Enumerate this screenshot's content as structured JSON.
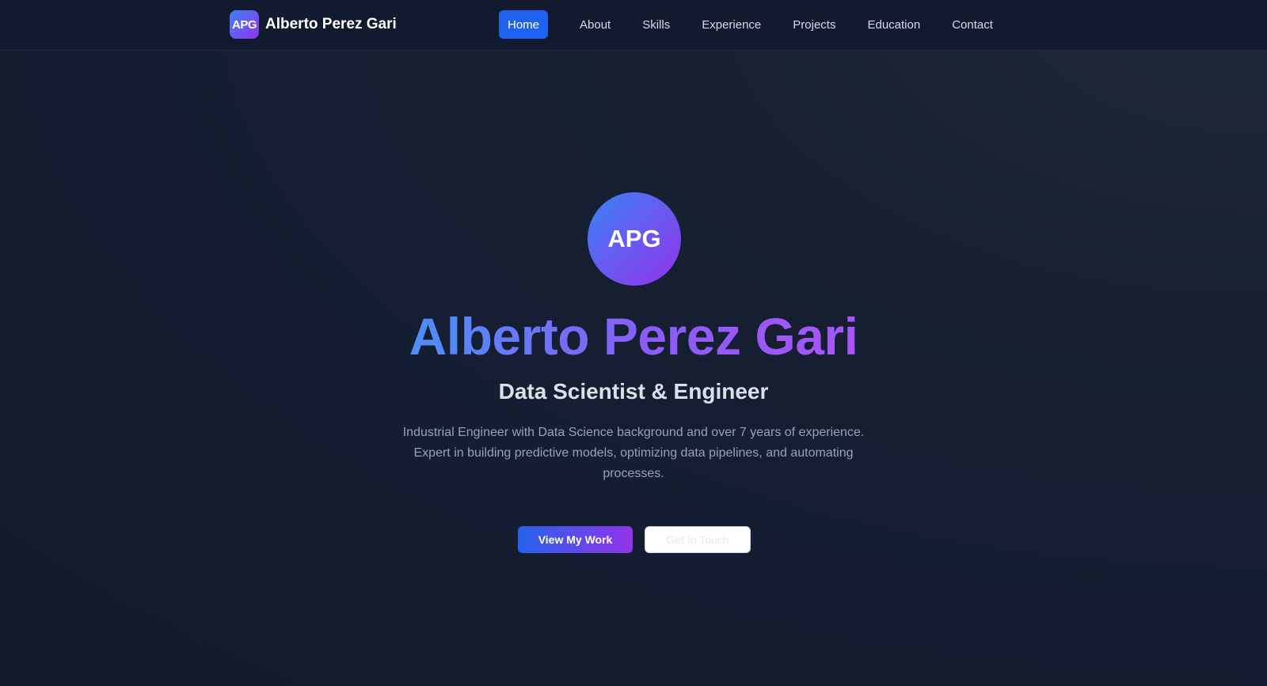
{
  "brand": {
    "logo_text": "APG",
    "name": "Alberto Perez Gari"
  },
  "nav": {
    "items": [
      {
        "label": "Home",
        "active": true
      },
      {
        "label": "About",
        "active": false
      },
      {
        "label": "Skills",
        "active": false
      },
      {
        "label": "Experience",
        "active": false
      },
      {
        "label": "Projects",
        "active": false
      },
      {
        "label": "Education",
        "active": false
      },
      {
        "label": "Contact",
        "active": false
      }
    ]
  },
  "hero": {
    "avatar_text": "APG",
    "name": "Alberto Perez Gari",
    "title": "Data Scientist & Engineer",
    "description": "Industrial Engineer with Data Science background and over 7 years of experience. Expert in building predictive models, optimizing data pipelines, and automating processes.",
    "primary_button": "View My Work",
    "secondary_button": "Get In Touch"
  },
  "colors": {
    "background": "#141c30",
    "navbar": "#111a2e",
    "active_nav": "#1d63f0",
    "gradient_start": "#3b82f6",
    "gradient_end": "#9333ea"
  }
}
